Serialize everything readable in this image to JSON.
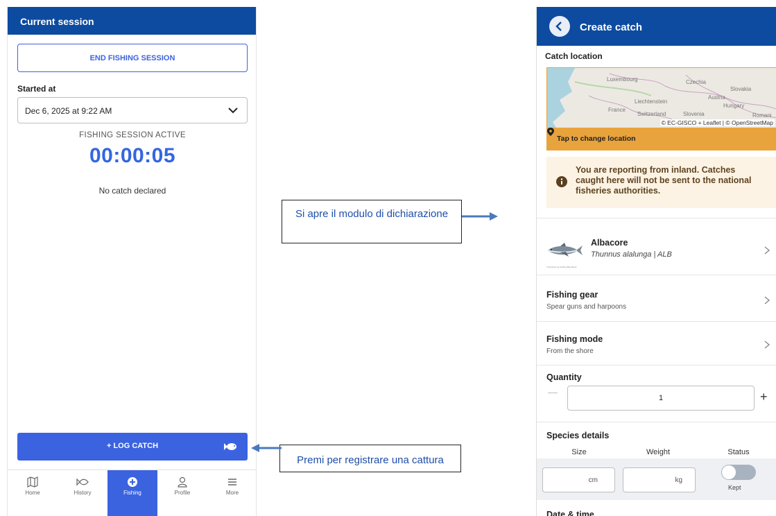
{
  "left": {
    "header_title": "Current session",
    "end_button": "END FISHING SESSION",
    "started_label": "Started at",
    "started_value": "Dec 6, 2025 at 9:22 AM",
    "session_status": "FISHING SESSION ACTIVE",
    "timer": "00:00:05",
    "no_catch": "No catch declared",
    "log_button": "+ LOG CATCH",
    "nav": [
      {
        "label": "Home",
        "icon": "map-icon"
      },
      {
        "label": "History",
        "icon": "fish-outline-icon"
      },
      {
        "label": "Fishing",
        "icon": "plus-circle-icon",
        "active": true
      },
      {
        "label": "Profile",
        "icon": "person-icon"
      },
      {
        "label": "More",
        "icon": "menu-icon"
      }
    ]
  },
  "callouts": {
    "top": "Si apre il modulo di dichiarazione",
    "bottom": "Premi per registrare una cattura"
  },
  "right": {
    "header_title": "Create catch",
    "catch_location_label": "Catch location",
    "map": {
      "labels": [
        "Luxembourg",
        "Czechia",
        "Slovakia",
        "Austria",
        "Liechtenstein",
        "Hungary",
        "France",
        "Switzerland",
        "Slovenia",
        "Romani"
      ],
      "attribution": "© EC-GISCO + Leaflet | © OpenStreetMap",
      "tap_label": "Tap to change location"
    },
    "warning": "You are reporting from inland. Catches caught here will not be sent to the national fisheries authorities.",
    "species": {
      "name": "Albacore",
      "scientific": "Thunnus alalunga | ALB",
      "credit": "© Eurofins for Fishing Blue Book"
    },
    "fishing_gear": {
      "title": "Fishing gear",
      "value": "Spear guns and harpoons"
    },
    "fishing_mode": {
      "title": "Fishing mode",
      "value": "From the shore"
    },
    "quantity": {
      "label": "Quantity",
      "value": "1",
      "plus": "+"
    },
    "species_details": {
      "label": "Species details",
      "columns": [
        "Size",
        "Weight",
        "Status"
      ],
      "size_unit": "cm",
      "weight_unit": "kg",
      "status": "Kept"
    },
    "datetime_label": "Date & time"
  },
  "colors": {
    "header_blue": "#0d4ba0",
    "accent_blue": "#3b63e0",
    "map_orange": "#e9a33d",
    "warning_bg": "#fdf3e4"
  }
}
